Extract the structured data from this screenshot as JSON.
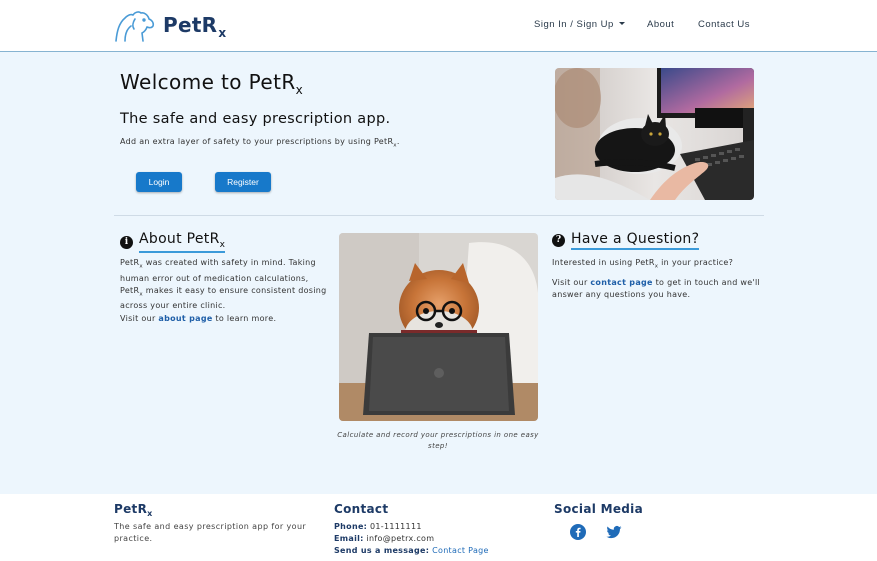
{
  "nav": {
    "brand_main": "PetR",
    "brand_sub": "x",
    "links": {
      "signin": "Sign In / Sign Up",
      "about": "About",
      "contact": "Contact Us"
    }
  },
  "hero": {
    "title_main": "Welcome to PetR",
    "title_sub": "x",
    "subtitle": "The safe and easy prescription app.",
    "desc_before": "Add an extra layer of safety to your prescriptions by using PetR",
    "desc_sub": "x",
    "desc_after": ".",
    "login_label": "Login",
    "register_label": "Register"
  },
  "about": {
    "heading_main": "About PetR",
    "heading_sub": "x",
    "p1_a": "PetR",
    "p1_sub": "x",
    "p1_b": " was created with safety in mind. Taking human error out of medication calculations, PetR",
    "p1_sub2": "x",
    "p1_c": " makes it easy to ensure consistent dosing across your entire clinic.",
    "p2_before": "Visit our ",
    "p2_link": "about page",
    "p2_after": " to learn more."
  },
  "photo_caption": "Calculate and record your prescriptions in one easy step!",
  "question": {
    "heading": "Have a Question?",
    "p1_before": "Interested in using PetR",
    "p1_sub": "x",
    "p1_after": " in your practice?",
    "p2_before": "Visit our ",
    "p2_link": "contact page",
    "p2_after": " to get in touch and we'll answer any questions you have."
  },
  "footer": {
    "brand_main": "PetR",
    "brand_sub": "x",
    "desc": "The safe and easy prescription app for your practice.",
    "contact_title": "Contact",
    "phone_label": "Phone:",
    "phone_value": " 01-1111111",
    "email_label": "Email:",
    "email_value": " info@petrx.com",
    "message_label": "Send us a message:",
    "message_link": "Contact Page",
    "social_title": "Social Media",
    "social_icons": [
      "facebook-icon",
      "twitter-icon"
    ]
  },
  "colors": {
    "brand": "#1d3a66",
    "button": "#1779ca",
    "underline": "#3b9ad9",
    "background": "#edf6fd"
  }
}
